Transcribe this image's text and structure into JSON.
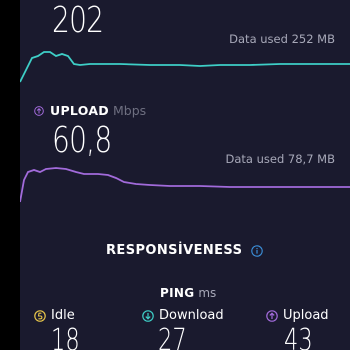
{
  "download": {
    "value": "202",
    "data_used": "Data used 252 MB",
    "graph_color": "#3ecfc7"
  },
  "upload": {
    "label": "UPLOAD",
    "unit": "Mbps",
    "value": "60,8",
    "data_used": "Data used 78,7 MB",
    "graph_color": "#a26bdb",
    "icon": "upload-arrow-icon"
  },
  "responsiveness": {
    "title": "RESPONSİVENESS",
    "icon": "info-icon",
    "icon_color": "#3b8fd9"
  },
  "ping": {
    "label": "PING",
    "unit": "ms",
    "items": [
      {
        "label": "Idle",
        "value": "18",
        "icon": "idle-icon",
        "icon_color": "#e7c54a"
      },
      {
        "label": "Download",
        "value": "27",
        "icon": "download-arrow-icon",
        "icon_color": "#3ecfc7"
      },
      {
        "label": "Upload",
        "value": "43",
        "icon": "upload-arrow-icon",
        "icon_color": "#a26bdb"
      }
    ]
  }
}
